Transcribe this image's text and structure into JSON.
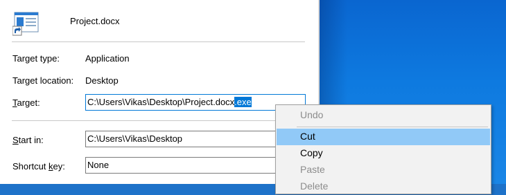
{
  "window": {
    "file_name": "Project.docx"
  },
  "properties": {
    "target_type_label": "Application",
    "target_location_label": "Desktop",
    "labels": {
      "target_type": "Target type:",
      "target_location": "Target location:",
      "target_pre": "",
      "target_u": "T",
      "target_post": "arget:",
      "start_in_u": "S",
      "start_in_post": "tart in:",
      "shortcut_pre": "Shortcut ",
      "shortcut_u": "k",
      "shortcut_post": "ey:"
    },
    "target_value_plain": "C:\\Users\\Vikas\\Desktop\\Project.docx",
    "target_value_selected": ".exe",
    "start_in_value": "C:\\Users\\Vikas\\Desktop",
    "shortcut_key_value": "None"
  },
  "context_menu": {
    "items": [
      {
        "label": "Undo",
        "enabled": false
      },
      {
        "label": "Cut",
        "enabled": true,
        "highlighted": true
      },
      {
        "label": "Copy",
        "enabled": true
      },
      {
        "label": "Paste",
        "enabled": false
      },
      {
        "label": "Delete",
        "enabled": false
      }
    ]
  },
  "colors": {
    "selection": "#0078d7",
    "menu_hover": "#91c9f7",
    "desktop": "#0e7ae0"
  },
  "icons": {
    "file": "application-shortcut-icon"
  }
}
